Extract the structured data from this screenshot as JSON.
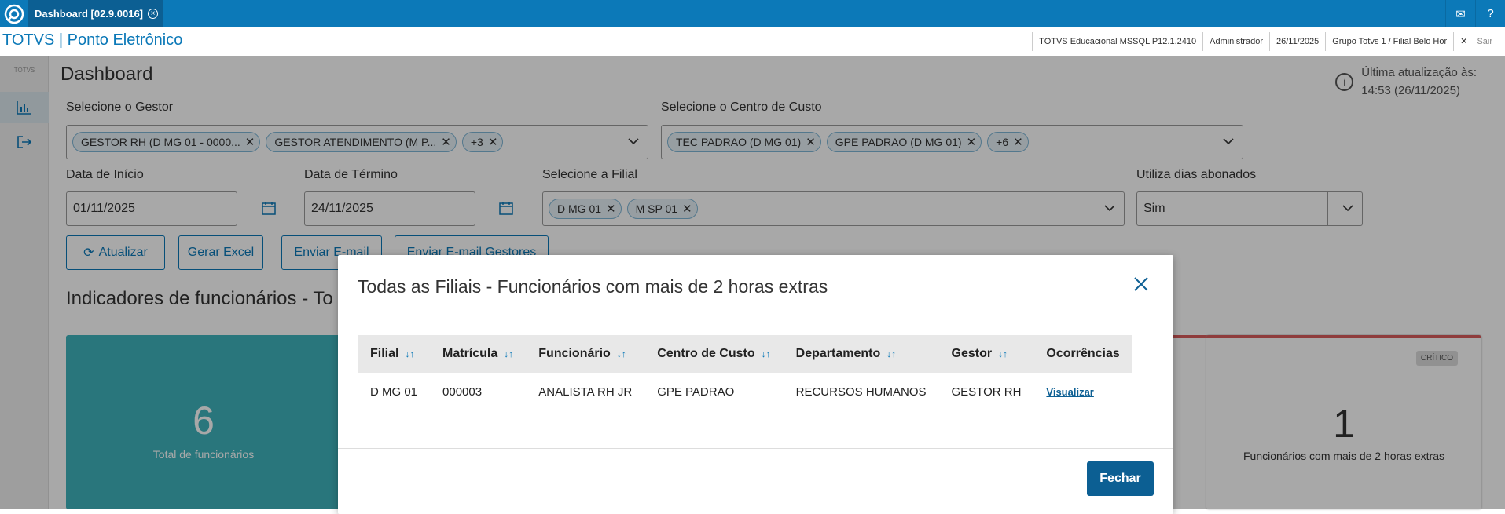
{
  "window": {
    "tab_label": "Dashboard [02.9.0016]",
    "app_title": "TOTVS | Ponto Eletrônico",
    "info_items": [
      "TOTVS Educacional MSSQL P12.1.2410",
      "Administrador",
      "26/11/2025",
      "Grupo Totvs 1 / Filial Belo Hor"
    ],
    "sair_label": "Sair"
  },
  "sidebar": {
    "brand": "TOTVS"
  },
  "dashboard": {
    "title": "Dashboard",
    "last_update_label": "Última atualização às:",
    "last_update_value": "14:53 (26/11/2025)",
    "gestor": {
      "label": "Selecione o Gestor",
      "chips": [
        "GESTOR RH (D MG 01 - 0000...",
        "GESTOR ATENDIMENTO (M P...",
        "+3"
      ]
    },
    "centro_custo": {
      "label": "Selecione o Centro de Custo",
      "chips": [
        "TEC PADRAO (D MG 01)",
        "GPE PADRAO (D MG 01)",
        "+6"
      ]
    },
    "data_inicio": {
      "label": "Data de Início",
      "value": "01/11/2025"
    },
    "data_termino": {
      "label": "Data de Término",
      "value": "24/11/2025"
    },
    "filial": {
      "label": "Selecione a Filial",
      "chips": [
        "D MG 01",
        "M SP 01"
      ]
    },
    "dias_abonados": {
      "label": "Utiliza dias abonados",
      "value": "Sim"
    },
    "buttons": {
      "atualizar": "Atualizar",
      "excel": "Gerar Excel",
      "email": "Enviar E-mail",
      "email_gestores": "Enviar E-mail Gestores"
    },
    "section_title": "Indicadores de funcionários - To",
    "card_total": {
      "value": "6",
      "label": "Total de funcionários"
    },
    "card_extras": {
      "badge": "CRÍTICO",
      "value": "1",
      "label": "Funcionários com mais de 2 horas extras"
    }
  },
  "modal": {
    "title": "Todas as Filiais - Funcionários com mais de 2 horas extras",
    "columns": [
      "Filial",
      "Matrícula",
      "Funcionário",
      "Centro de Custo",
      "Departamento",
      "Gestor",
      "Ocorrências"
    ],
    "rows": [
      [
        "D MG 01",
        "000003",
        "ANALISTA RH JR",
        "GPE PADRAO",
        "RECURSOS HUMANOS",
        "GESTOR RH",
        "Visualizar"
      ]
    ],
    "close_button": "Fechar"
  },
  "colors": {
    "brand": "#0c79b8",
    "brand_dark": "#0c5f93",
    "card_teal": "#3fb4bc",
    "critical": "#d95c5c"
  },
  "icons": [
    "totvs-logo-icon",
    "close-circle-icon",
    "mail-icon",
    "help-icon",
    "chart-icon",
    "logout-icon",
    "info-icon",
    "calendar-icon",
    "chevron-down-icon",
    "refresh-icon",
    "sort-icon",
    "close-icon"
  ]
}
